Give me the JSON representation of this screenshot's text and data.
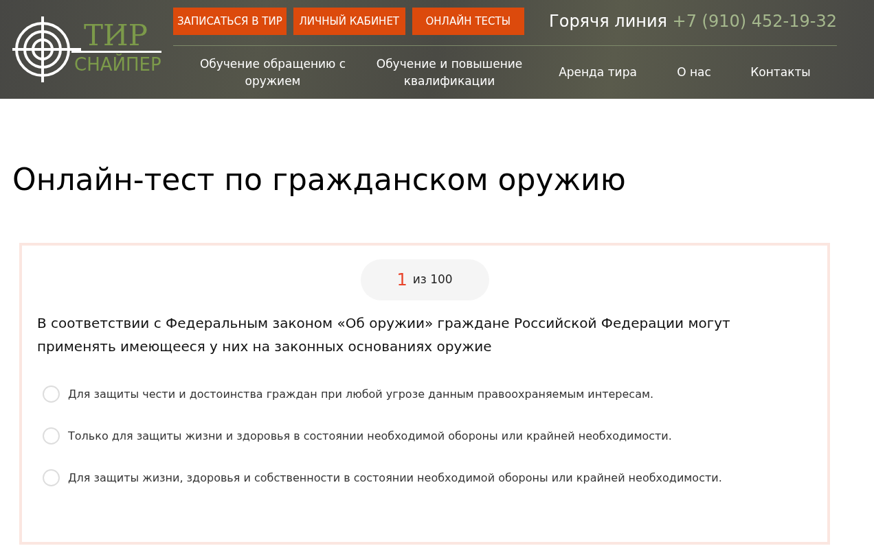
{
  "header": {
    "logo": {
      "line_1": "ТИР",
      "line_2": "СНАЙПЕР"
    },
    "buttons": [
      "ЗАПИСАТЬСЯ В ТИР",
      "ЛИЧНЫЙ КАБИНЕТ",
      "ОНЛАЙН ТЕСТЫ"
    ],
    "hotline": {
      "label": "Горячя линия",
      "phone": "+7 (910) 452-19-32"
    },
    "nav": [
      "Обучение обращению с оружием",
      "Обучение и повышение квалификации",
      "Аренда тира",
      "О нас",
      "Контакты"
    ]
  },
  "title": "Онлайн-тест по гражданском оружию",
  "quiz": {
    "counter": {
      "current": "1",
      "total": "из 100"
    },
    "question": "В соответствии с Федеральным законом «Об оружии» граждане Российской Федерации могут применять имеющееся у них на законных основаниях оружие",
    "options": [
      {
        "text": "Для защиты чести и достоинства граждан при любой угрозе данным правоохраняемым интересам.",
        "selected": false
      },
      {
        "text": "Только для защиты жизни и здоровья в состоянии необходимой обороны или крайней необходимости.",
        "selected": false
      },
      {
        "text": "Для защиты жизни, здоровья и собственности в состоянии необходимой обороны или крайней необходимости.",
        "selected": false
      }
    ]
  }
}
